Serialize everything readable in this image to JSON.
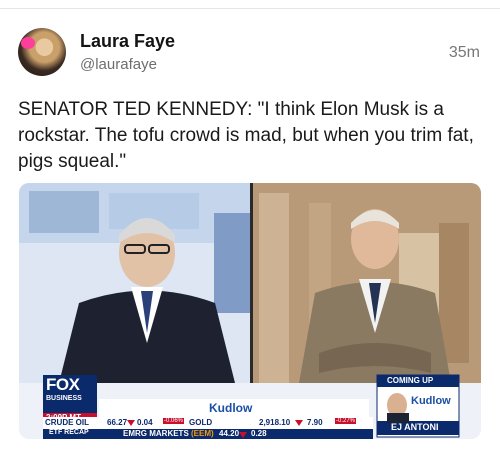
{
  "post": {
    "author_name": "Laura Faye",
    "author_handle": "@laurafaye",
    "timestamp": "35m",
    "text": "SENATOR TED KENNEDY: \"I think Elon Musk is a rockstar. The tofu crowd is mad, but when you trim fat, pigs squeal.\""
  },
  "media": {
    "network": "FOX",
    "network_sub": "BUSINESS",
    "clock": "2:09P MT",
    "show_name": "Kudlow",
    "coming_up_label": "COMING UP",
    "coming_up_show": "Kudlow",
    "coming_up_guest": "EJ ANTONI",
    "ticker_row1": {
      "label": "CRUDE OIL",
      "price": "66.27",
      "change": "0.04",
      "pct": "-0.06%",
      "label2": "GOLD",
      "price2": "2,918.10",
      "change2": "7.90",
      "pct2": "-0.27%"
    },
    "ticker_row2": {
      "label": "ETF RECAP",
      "item": "EMRG MARKETS",
      "symbol": "(EEM)",
      "price": "44.20",
      "change": "0.28"
    }
  },
  "colors": {
    "fox_blue": "#0b2a6b",
    "ticker_red": "#c8102e",
    "accent_orange": "#f39c12"
  }
}
